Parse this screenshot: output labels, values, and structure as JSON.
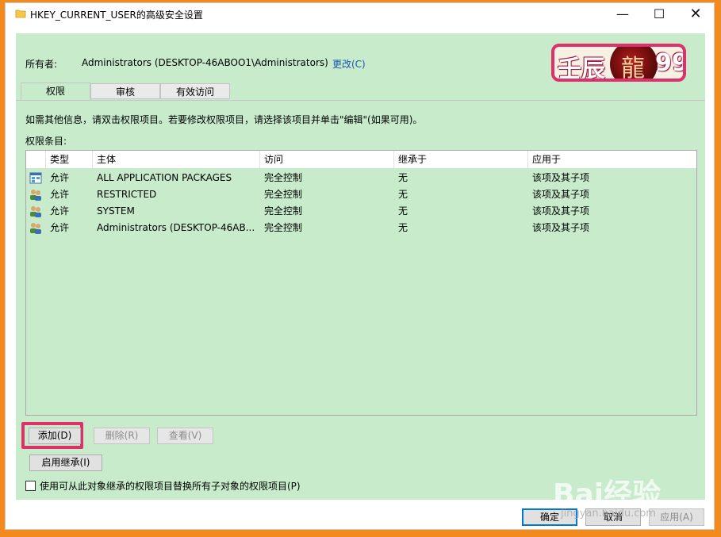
{
  "window": {
    "title": "HKEY_CURRENT_USER的高级安全设置",
    "minimize_glyph": "—",
    "maximize_glyph": "☐",
    "close_glyph": "✕"
  },
  "owner": {
    "label": "所有者:",
    "value": "Administrators (DESKTOP-46ABOO1\\Administrators)",
    "change_link": "更改(C)"
  },
  "logo": {
    "text_left": "壬辰",
    "text_right": "99",
    "dragon_glyph": "龍"
  },
  "tabs": [
    "权限",
    "审核",
    "有效访问"
  ],
  "active_tab": "权限",
  "info_text": "如需其他信息，请双击权限项目。若要修改权限项目，请选择该项目并单击\"编辑\"(如果可用)。",
  "entries_label": "权限条目:",
  "table": {
    "columns": [
      "类型",
      "主体",
      "访问",
      "继承于",
      "应用于"
    ],
    "rows": [
      {
        "icon": "app-packages-icon",
        "type": "允许",
        "principal": "ALL APPLICATION PACKAGES",
        "access": "完全控制",
        "inherited": "无",
        "applies": "该项及其子项"
      },
      {
        "icon": "user-group-icon",
        "type": "允许",
        "principal": "RESTRICTED",
        "access": "完全控制",
        "inherited": "无",
        "applies": "该项及其子项"
      },
      {
        "icon": "user-group-icon",
        "type": "允许",
        "principal": "SYSTEM",
        "access": "完全控制",
        "inherited": "无",
        "applies": "该项及其子项"
      },
      {
        "icon": "user-group-icon",
        "type": "允许",
        "principal": "Administrators (DESKTOP-46AB...",
        "access": "完全控制",
        "inherited": "无",
        "applies": "该项及其子项"
      }
    ]
  },
  "buttons": {
    "add": "添加(D)",
    "remove": "删除(R)",
    "view": "查看(V)",
    "enable_inheritance": "启用继承(I)"
  },
  "checkbox": {
    "label": "使用可从此对象继承的权限项目替换所有子对象的权限项目(P)",
    "checked": false
  },
  "footer": {
    "ok": "确定",
    "cancel": "取消",
    "apply": "应用(A)"
  },
  "watermark": {
    "main": "Bai经验",
    "sub": "jingyan.baidu.com"
  },
  "colors": {
    "background_orange": "#f28a1e",
    "content_green": "#c7ebcb",
    "highlight_pink": "#e0306c",
    "link_blue": "#1c55b5"
  }
}
